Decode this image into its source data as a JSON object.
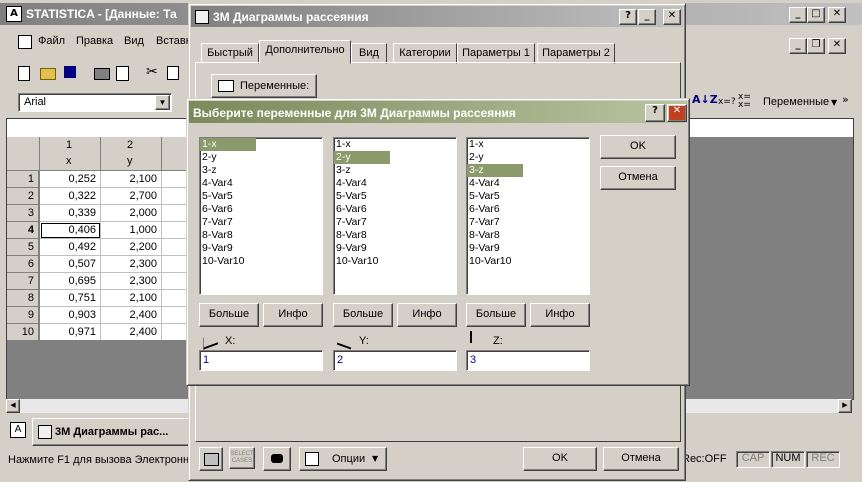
{
  "main": {
    "title": "STATISTICA - [Данные: Та",
    "menu": [
      "Файл",
      "Правка",
      "Вид",
      "Вставк"
    ],
    "font_name": "Arial",
    "right_toolbar_label": "Переменные",
    "table": {
      "col_headers": [
        {
          "num": "1",
          "name": "x"
        },
        {
          "num": "2",
          "name": "y"
        }
      ],
      "rows": [
        {
          "n": "1",
          "x": "0,252",
          "y": "2,100"
        },
        {
          "n": "2",
          "x": "0,322",
          "y": "2,700"
        },
        {
          "n": "3",
          "x": "0,339",
          "y": "2,000"
        },
        {
          "n": "4",
          "x": "0,406",
          "y": "1,000"
        },
        {
          "n": "5",
          "x": "0,492",
          "y": "2,200"
        },
        {
          "n": "6",
          "x": "0,507",
          "y": "2,300"
        },
        {
          "n": "7",
          "x": "0,695",
          "y": "2,300"
        },
        {
          "n": "8",
          "x": "0,751",
          "y": "2,100"
        },
        {
          "n": "9",
          "x": "0,903",
          "y": "2,400"
        },
        {
          "n": "10",
          "x": "0,971",
          "y": "2,400"
        }
      ]
    },
    "taskbar_item": "3М Диаграммы рас...",
    "status_text": "Нажмите F1 для вызова Электронн",
    "status_indicators": [
      "Rec:OFF",
      "CAP",
      "NUM",
      "REC"
    ]
  },
  "scatter_dialog": {
    "title": "3М Диаграммы рассеяния",
    "tabs": [
      "Быстрый",
      "Дополнительно",
      "Вид",
      "Категории",
      "Параметры 1",
      "Параметры 2"
    ],
    "variables_button": "Переменные:",
    "bottom_options": "Опции",
    "ok": "OK",
    "cancel": "Отмена"
  },
  "var_dialog": {
    "title": "Выберите переменные для 3М Диаграммы рассеяния",
    "variables": [
      "1-x",
      "2-y",
      "3-z",
      "4-Var4",
      "5-Var5",
      "6-Var6",
      "7-Var7",
      "8-Var8",
      "9-Var9",
      "10-Var10"
    ],
    "ok": "OK",
    "cancel": "Отмена",
    "more_label": "Больше",
    "info_label": "Инфо",
    "axes": [
      {
        "label": "X:",
        "value": "1"
      },
      {
        "label": "Y:",
        "value": "2"
      },
      {
        "label": "Z:",
        "value": "3"
      }
    ]
  }
}
